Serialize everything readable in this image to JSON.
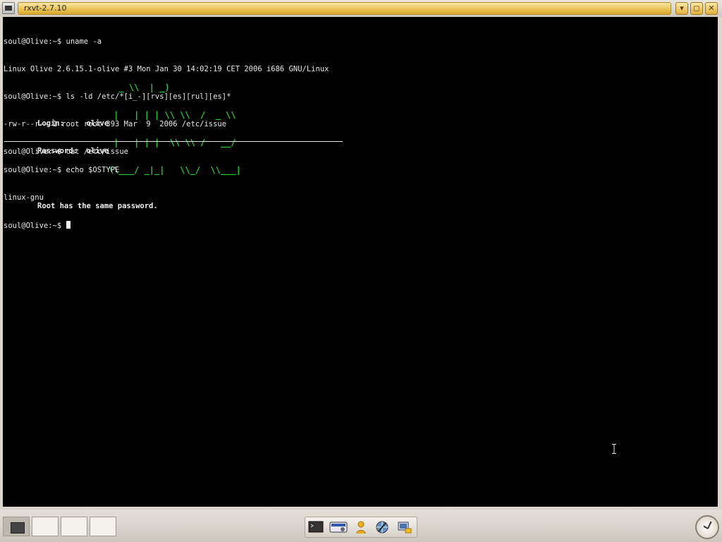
{
  "window": {
    "title": "rxvt-2.7.10",
    "buttons": {
      "minimize": "▾",
      "maximize": "◻",
      "close": "✕"
    }
  },
  "terminal": {
    "lines": [
      "soul@Olive:~$ uname -a",
      "Linux Olive 2.6.15.1-olive #3 Mon Jan 30 14:02:19 CET 2006 i686 GNU/Linux",
      "soul@Olive:~$ ls -ld /etc/*[i_-][rvs][es][rul][es]*",
      "-rw-r--r-- 1 root root 393 Mar  9  2006 /etc/issue",
      "soul@Olive:~$ cat /etc/issue"
    ],
    "ascii_art": [
      "  _ \\\\  | _)",
      " |   | | | \\\\ \\\\  /  _ \\\\",
      " |   | | |  \\\\ \\\\ /   __/",
      "\\\\___/ _|_|   \\\\_/  \\\\___|"
    ],
    "issue": [
      "Login:     olive",
      "Password:  olive",
      "",
      "Root has the same password."
    ],
    "after": [
      "soul@Olive:~$ echo $OSTYPE",
      "linux-gnu"
    ],
    "prompt": "soul@Olive:~$ "
  },
  "panel": {
    "workspaces": 4,
    "launchers": [
      "terminal-icon",
      "media-player-icon",
      "user-icon",
      "web-browser-icon",
      "file-manager-icon"
    ],
    "clock_icon": "clock-icon"
  },
  "colors": {
    "terminal_bg": "#000000",
    "terminal_fg": "#e8e8e8",
    "ascii_green": "#22d033",
    "title_accent": "#e8c050"
  }
}
